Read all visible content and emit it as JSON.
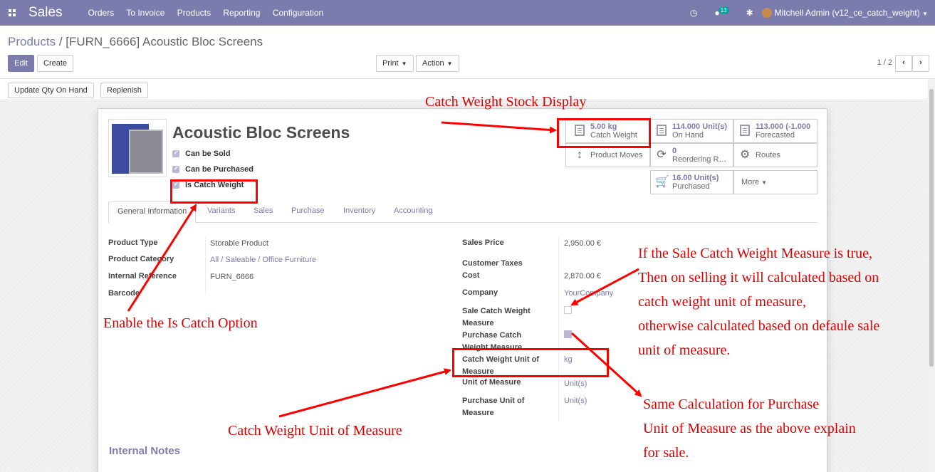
{
  "navbar": {
    "app_name": "Sales",
    "menu": [
      "Orders",
      "To Invoice",
      "Products",
      "Reporting",
      "Configuration"
    ],
    "chat_badge": "13",
    "user": "Mitchell Admin (v12_ce_catch_weight)"
  },
  "breadcrumb": {
    "parent": "Products",
    "separator": " / ",
    "current": "[FURN_6666] Acoustic Bloc Screens"
  },
  "buttons": {
    "edit": "Edit",
    "create": "Create",
    "print": "Print",
    "action": "Action",
    "update_qty": "Update Qty On Hand",
    "replenish": "Replenish"
  },
  "pager": {
    "value": "1 / 2",
    "prev": "‹",
    "next": "›"
  },
  "product": {
    "name": "Acoustic Bloc Screens",
    "can_be_sold": "Can be Sold",
    "can_be_purchased": "Can be Purchased",
    "is_catch_weight": "Is Catch Weight"
  },
  "smart_buttons": {
    "catch_weight": {
      "value": "5.00 kg",
      "label": "Catch Weight"
    },
    "on_hand": {
      "value": "114.000 Unit(s)",
      "label": "On Hand"
    },
    "forecasted": {
      "value": "113.000 (-1.000",
      "label": "Forecasted"
    },
    "product_moves": {
      "label": "Product Moves"
    },
    "reordering": {
      "value": "0",
      "label": "Reordering R…"
    },
    "routes": {
      "label": "Routes"
    },
    "purchased": {
      "value": "16.00 Unit(s)",
      "label": "Purchased"
    },
    "more": {
      "label": "More"
    }
  },
  "tabs": [
    "General Information",
    "Variants",
    "Sales",
    "Purchase",
    "Inventory",
    "Accounting"
  ],
  "left_fields": {
    "product_type": {
      "label": "Product Type",
      "value": "Storable Product"
    },
    "product_category": {
      "label": "Product Category",
      "value": "All / Saleable / Office Furniture"
    },
    "internal_reference": {
      "label": "Internal Reference",
      "value": "FURN_6666"
    },
    "barcode": {
      "label": "Barcode",
      "value": ""
    }
  },
  "right_fields": {
    "sales_price": {
      "label": "Sales Price",
      "value": "2,950.00 €"
    },
    "customer_taxes": {
      "label": "Customer Taxes",
      "value": ""
    },
    "cost": {
      "label": "Cost",
      "value": "2,870.00 €"
    },
    "company": {
      "label": "Company",
      "value": "YourCompany"
    },
    "sale_cw_measure": {
      "label_1": "Sale Catch Weight",
      "label_2": "Measure",
      "checked": false
    },
    "purchase_cw_measure": {
      "label_1": "Purchase Catch",
      "label_2": "Weight Measure",
      "checked": true
    },
    "cw_uom": {
      "label_1": "Catch Weight Unit of",
      "label_2": "Measure",
      "value": "kg"
    },
    "uom": {
      "label": "Unit of Measure",
      "value": "Unit(s)"
    },
    "purchase_uom": {
      "label_1": "Purchase Unit of",
      "label_2": "Measure",
      "value": "Unit(s)"
    }
  },
  "internal_notes": "Internal Notes",
  "annotations": {
    "stock_display": "Catch Weight Stock Display",
    "enable_option": "Enable the Is Catch Option",
    "cw_uom": "Catch Weight Unit of Measure",
    "sale_explain": [
      "If the Sale Catch Weight Measure is true,",
      "Then on selling it will calculated based on",
      "catch weight unit of measure,",
      "otherwise calculated based on defaule sale",
      "unit of measure."
    ],
    "purchase_explain": [
      "Same Calculation for Purchase",
      "Unit of Measure as the above explain",
      "for sale."
    ]
  },
  "colors": {
    "navbar": "#7c7bad",
    "annotation": "#e00000"
  }
}
